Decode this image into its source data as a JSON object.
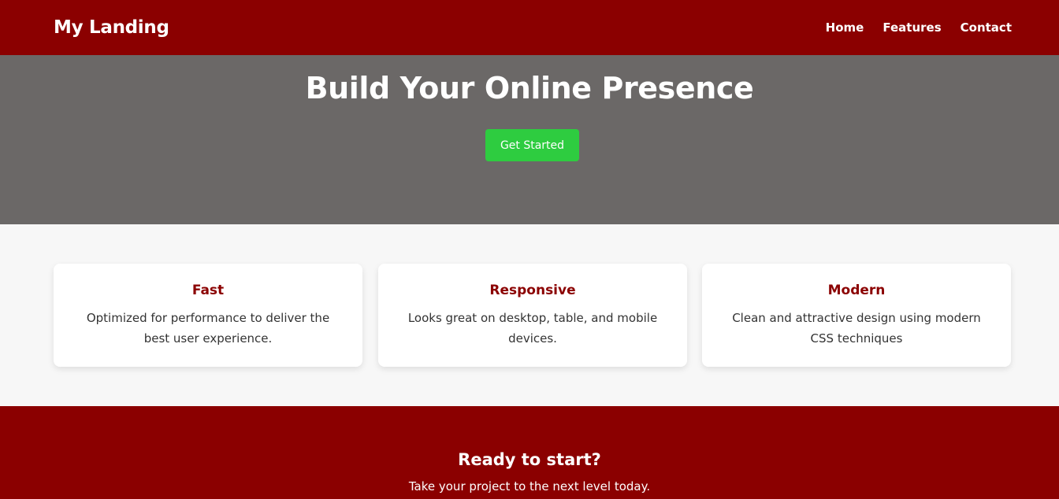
{
  "header": {
    "logo": "My Landing",
    "nav": [
      "Home",
      "Features",
      "Contact"
    ]
  },
  "hero": {
    "title": "Build Your Online Presence",
    "button_label": "Get Started"
  },
  "features": [
    {
      "title": "Fast",
      "text": "Optimized for performance to deliver the best user experience."
    },
    {
      "title": "Responsive",
      "text": "Looks great on desktop, table, and mobile devices."
    },
    {
      "title": "Modern",
      "text": "Clean and attractive design using modern CSS techniques"
    }
  ],
  "cta": {
    "title": "Ready to start?",
    "text": "Take your project to the next level today."
  },
  "colors": {
    "brand": "#8b0000",
    "hero_background": "#6b6867",
    "accent": "#2ecc40",
    "page_background": "#f7f7f7"
  }
}
